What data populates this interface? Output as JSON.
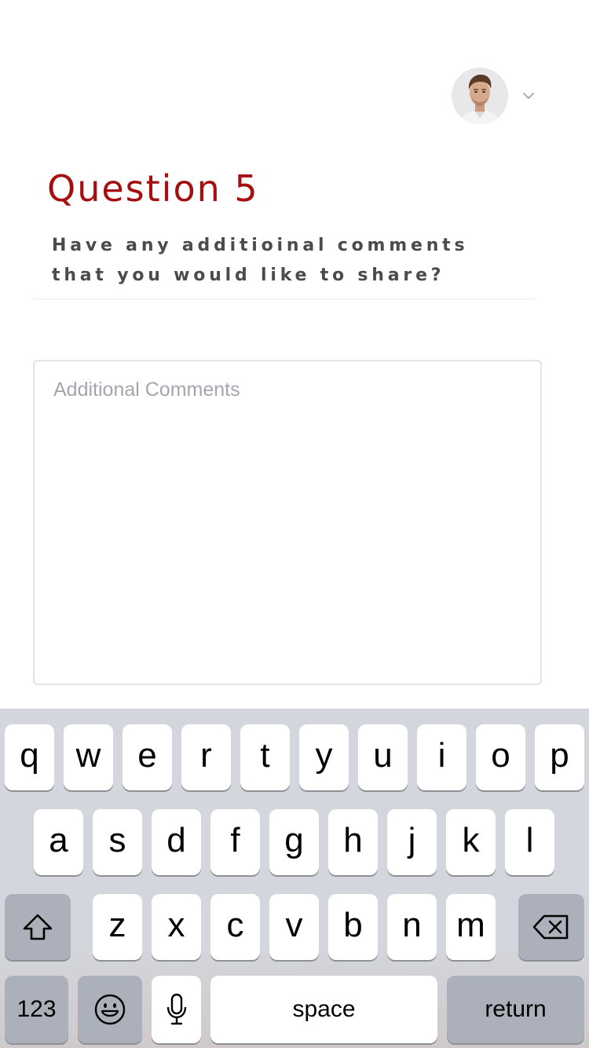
{
  "header": {
    "avatar_alt": "User avatar",
    "chevron": "chevron-down-icon"
  },
  "question": {
    "title": "Question 5",
    "text_line1": "Have any additioinal comments",
    "text_line2": "that you would like to share?"
  },
  "comment": {
    "placeholder": "Additional Comments",
    "value": ""
  },
  "keyboard": {
    "row1": [
      "q",
      "w",
      "e",
      "r",
      "t",
      "y",
      "u",
      "i",
      "o",
      "p"
    ],
    "row2": [
      "a",
      "s",
      "d",
      "f",
      "g",
      "h",
      "j",
      "k",
      "l"
    ],
    "row3": [
      "z",
      "x",
      "c",
      "v",
      "b",
      "n",
      "m"
    ],
    "shift_icon": "shift-icon",
    "delete_icon": "backspace-icon",
    "numbers_label": "123",
    "emoji_icon": "emoji-icon",
    "mic_icon": "microphone-icon",
    "space_label": "space",
    "return_label": "return"
  },
  "colors": {
    "accent": "#a50f0f",
    "question_text": "#4b4b4f",
    "placeholder": "#a3a6ad",
    "keyboard_bg": "#d3d6dc",
    "function_key": "#abb0ba"
  }
}
